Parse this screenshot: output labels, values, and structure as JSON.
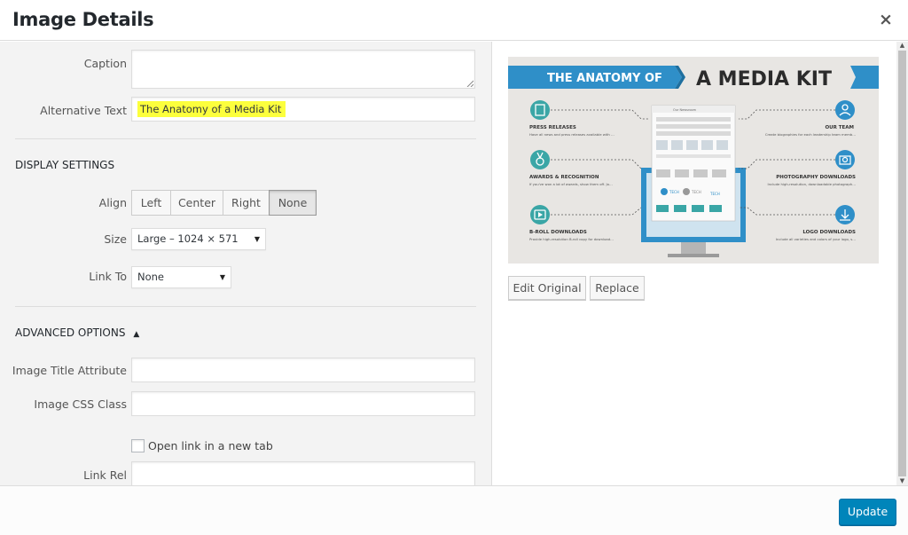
{
  "dialog": {
    "title": "Image Details",
    "close_symbol": "×"
  },
  "fields": {
    "caption_label": "Caption",
    "caption_value": "",
    "alt_label": "Alternative Text",
    "alt_value": "The Anatomy of a Media Kit"
  },
  "display": {
    "heading": "DISPLAY SETTINGS",
    "align_label": "Align",
    "align_options": [
      "Left",
      "Center",
      "Right",
      "None"
    ],
    "align_selected": "None",
    "size_label": "Size",
    "size_value": "Large – 1024 × 571",
    "link_label": "Link To",
    "link_value": "None"
  },
  "advanced": {
    "heading": "ADVANCED OPTIONS",
    "toggle_symbol": "▲",
    "title_attr_label": "Image Title Attribute",
    "title_attr_value": "",
    "css_class_label": "Image CSS Class",
    "css_class_value": "",
    "new_tab_label": "Open link in a new tab",
    "new_tab_checked": false,
    "link_rel_label": "Link Rel",
    "link_rel_value": ""
  },
  "preview": {
    "banner_left": "THE ANATOMY OF",
    "banner_right": "A MEDIA KIT",
    "items_left": [
      {
        "title": "PRESS RELEASES",
        "desc": "Have all news and press releases available with working links back to the original post."
      },
      {
        "title": "AWARDS & RECOGNITION",
        "desc": "If you've won a lot of awards, show them off. Journalists may see a trend or choose to talk about past recognition in their story."
      },
      {
        "title": "B-ROLL DOWNLOADS",
        "desc": "Provide high-resolution B-roll copy for download. When a TV station can't attend an event or film on site, they can utilize the b-roll during a story."
      }
    ],
    "items_right": [
      {
        "title": "OUR TEAM",
        "desc": "Create biographies for each leadership team member with portraits that are downloadable."
      },
      {
        "title": "PHOTOGRAPHY DOWNLOADS",
        "desc": "Include high-resolution, downloadable photography for editorial use only."
      },
      {
        "title": "LOGO DOWNLOADS",
        "desc": "Include all varieties and colors of your logo, saved with and without transparency."
      }
    ],
    "screen_header": "Our Newsroom",
    "logo_text": "TECH",
    "edit_label": "Edit Original",
    "replace_label": "Replace"
  },
  "footer": {
    "update_label": "Update"
  },
  "colors": {
    "accent": "#0085ba",
    "infographic_blue": "#2f8fc8",
    "infographic_teal": "#3aa6a6",
    "highlight": "#fcff3d"
  }
}
